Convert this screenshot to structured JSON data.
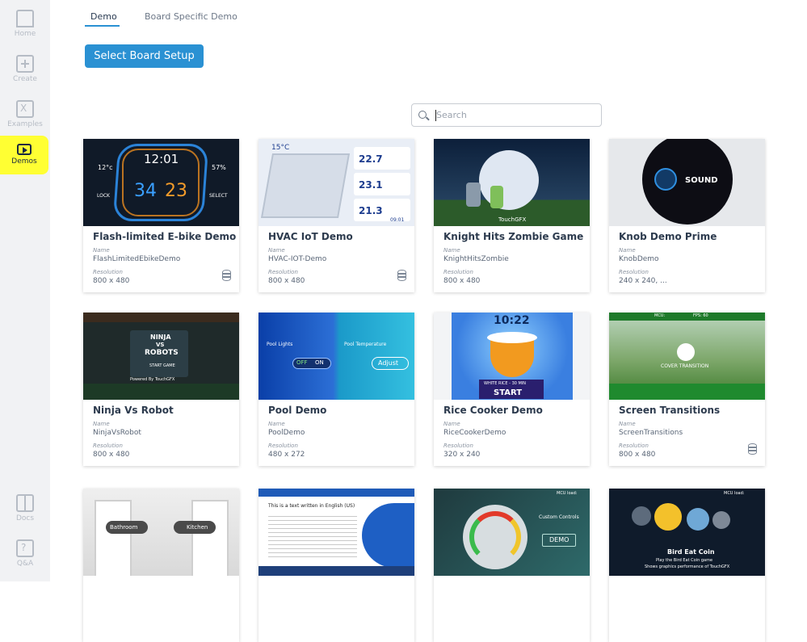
{
  "sidebar": {
    "items": [
      {
        "label": "Home"
      },
      {
        "label": "Create"
      },
      {
        "label": "Examples"
      },
      {
        "label": "Demos"
      },
      {
        "label": "Docs"
      },
      {
        "label": "Q&A"
      }
    ]
  },
  "tabs": [
    {
      "label": "Demo"
    },
    {
      "label": "Board Specific Demo"
    }
  ],
  "select_button_label": "Select Board Setup",
  "search": {
    "placeholder": "Search"
  },
  "field_labels": {
    "name": "Name",
    "resolution": "Resolution"
  },
  "cards": [
    {
      "title": "Flash-limited E-bike Demo",
      "name": "FlashLimitedEbikeDemo",
      "resolution": "800 x 480",
      "thumb_text": [
        "12:01",
        "34",
        "23",
        "12°c",
        "57%",
        "LOCK",
        "SELECT"
      ]
    },
    {
      "title": "HVAC IoT Demo",
      "name": "HVAC-IOT-Demo",
      "resolution": "800 x 480",
      "thumb_text": [
        "15°C",
        "22.7",
        "23.1",
        "21.3",
        "09:01"
      ]
    },
    {
      "title": "Knight Hits Zombie Game",
      "name": "KnightHitsZombie",
      "resolution": "800 x 480",
      "thumb_text": [
        "TouchGFX"
      ]
    },
    {
      "title": "Knob Demo Prime",
      "name": "KnobDemo",
      "resolution": "240 x 240, ...",
      "thumb_text": [
        "SOUND"
      ]
    },
    {
      "title": "Ninja Vs Robot",
      "name": "NinjaVsRobot",
      "resolution": "800 x 480",
      "thumb_text": [
        "NINJA",
        "VS",
        "ROBOTS",
        "START GAME",
        "Powered By TouchGFX"
      ]
    },
    {
      "title": "Pool Demo",
      "name": "PoolDemo",
      "resolution": "480 x 272",
      "thumb_text": [
        "Pool Lights",
        "Pool Temperature",
        "OFF",
        "ON",
        "Adjust"
      ]
    },
    {
      "title": "Rice Cooker Demo",
      "name": "RiceCookerDemo",
      "resolution": "320 x 240",
      "thumb_text": [
        "10:22",
        "WHITE RICE - 30 MIN",
        "START"
      ]
    },
    {
      "title": "Screen Transitions",
      "name": "ScreenTransitions",
      "resolution": "800 x 480",
      "thumb_text": [
        "COVER TRANSITION",
        "MCU:",
        "FPS: 60"
      ]
    },
    {
      "title": "",
      "name": "",
      "resolution": "",
      "thumb_text": [
        "Bathroom",
        "Kitchen"
      ]
    },
    {
      "title": "",
      "name": "",
      "resolution": "",
      "thumb_text": [
        "This is a text written in English (US)"
      ]
    },
    {
      "title": "",
      "name": "",
      "resolution": "",
      "thumb_text": [
        "MCU load:",
        "Custom Controls",
        "DEMO"
      ]
    },
    {
      "title": "",
      "name": "",
      "resolution": "",
      "thumb_text": [
        "MCU load:",
        "Bird Eat Coin",
        "Play the Bird Eat Coin game",
        "Shows graphics performance of TouchGFX"
      ]
    }
  ],
  "colors": {
    "accent": "#2a91d3",
    "highlight": "#ffff33",
    "sidebar_bg": "#f1f2f4"
  }
}
